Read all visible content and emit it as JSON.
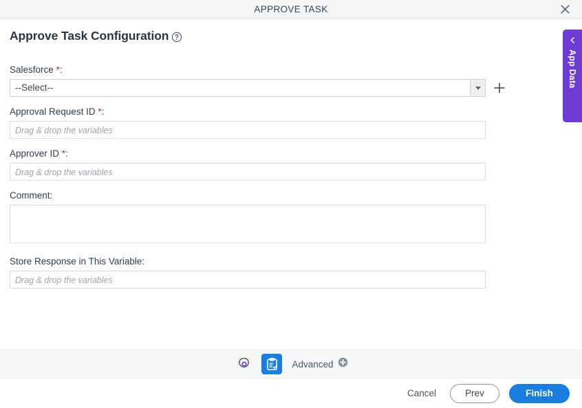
{
  "titlebar": {
    "title": "APPROVE TASK",
    "close_icon": "close-icon"
  },
  "heading": {
    "text": "Approve Task Configuration",
    "help_icon": "help-circle-icon"
  },
  "side_panel": {
    "label": "App Data",
    "collapse_icon": "chevron-left-icon",
    "color": "#6d3bd4"
  },
  "form": {
    "fields": [
      {
        "label": "Salesforce",
        "required": true,
        "type": "select",
        "value": "--Select--",
        "add_icon": "plus-icon"
      },
      {
        "label": "Approval Request ID",
        "required": true,
        "type": "text",
        "value": "",
        "placeholder": "Drag & drop the variables"
      },
      {
        "label": "Approver ID",
        "required": true,
        "type": "text",
        "value": "",
        "placeholder": "Drag & drop the variables"
      },
      {
        "label": "Comment",
        "required": false,
        "type": "textarea",
        "value": "",
        "placeholder": ""
      },
      {
        "label": "Store Response in This Variable",
        "required": false,
        "type": "text",
        "value": "",
        "placeholder": "Drag & drop the variables"
      }
    ],
    "required_marker": "*",
    "label_suffix": ":"
  },
  "toolbar": {
    "settings_icon": "gear-icon",
    "task_icon": "clipboard-check-icon",
    "advanced_label": "Advanced",
    "advanced_add_icon": "plus-circle-icon",
    "active_accent": "#1a7ee0",
    "gear_accent": "#6d3bd4"
  },
  "footer": {
    "cancel_label": "Cancel",
    "prev_label": "Prev",
    "finish_label": "Finish",
    "finish_color": "#1a7ee0"
  }
}
